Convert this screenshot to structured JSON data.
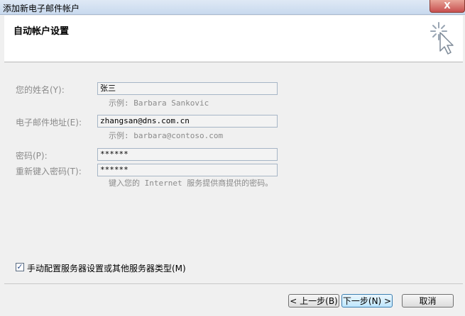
{
  "window": {
    "title": "添加新电子邮件帐户",
    "close_glyph": "X"
  },
  "header": {
    "title": "自动帐户设置"
  },
  "form": {
    "name": {
      "label": "您的姓名(Y):",
      "value": "张三",
      "hint": "示例: Barbara Sankovic"
    },
    "email": {
      "label": "电子邮件地址(E):",
      "value": "zhangsan@dns.com.cn",
      "hint": "示例: barbara@contoso.com"
    },
    "password": {
      "label": "密码(P):",
      "value": "******"
    },
    "password_confirm": {
      "label": "重新键入密码(T):",
      "value": "******",
      "hint": "键入您的 Internet 服务提供商提供的密码。"
    }
  },
  "manual_config": {
    "label": "手动配置服务器设置或其他服务器类型(M)",
    "checked": true,
    "check_glyph": "✓"
  },
  "buttons": {
    "back": "< 上一步(B)",
    "next": "下一步(N) >",
    "cancel": "取消"
  },
  "icons": {
    "header": "setup-wand-icon"
  },
  "colors": {
    "titlebar": "#c8d9ee",
    "close": "#c75050",
    "label_disabled": "#8b8b8b",
    "field_border": "#a6b5c6"
  }
}
